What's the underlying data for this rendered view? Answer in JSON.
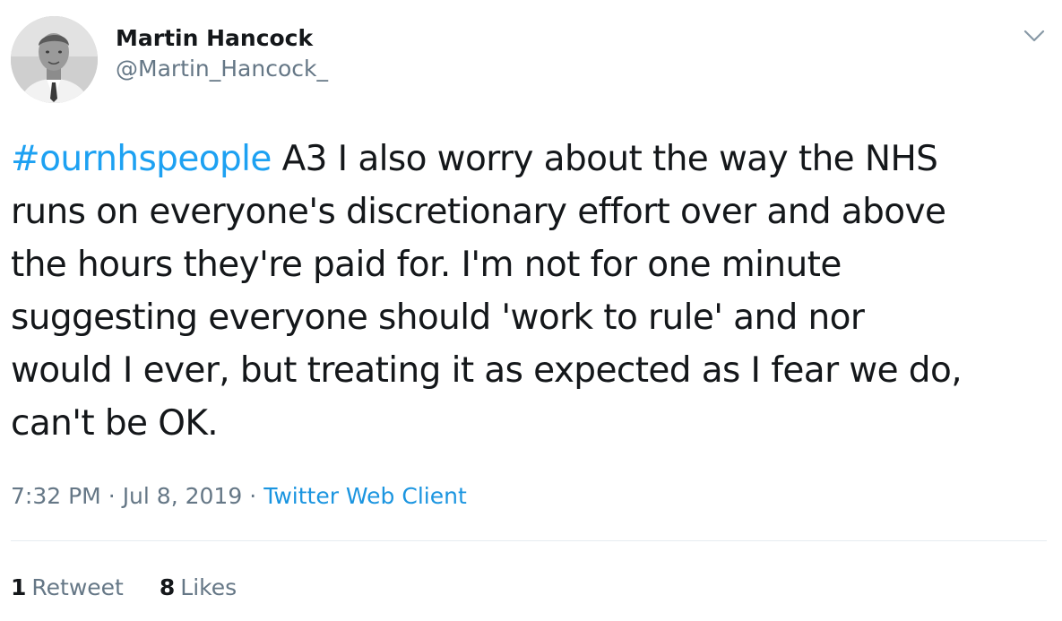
{
  "author": {
    "display_name": "Martin Hancock",
    "handle": "@Martin_Hancock_",
    "avatar_icon": "profile-photo"
  },
  "menu": {
    "icon": "chevron-down-icon"
  },
  "tweet": {
    "hashtag": "#ournhspeople",
    "line1_rest": " A3 I also worry about the way the NHS",
    "line2": "runs on everyone's discretionary effort over and above",
    "line3": "the hours they're paid for. I'm not for one minute",
    "line4": "suggesting everyone should 'work to rule' and nor",
    "line5": "would I ever, but treating it as expected as I fear we do,",
    "line6": "can't be OK."
  },
  "meta": {
    "time": "7:32 PM",
    "separator": "·",
    "date": "Jul 8, 2019",
    "source": "Twitter Web Client"
  },
  "stats": {
    "retweets_count": "1",
    "retweets_label": "Retweet",
    "likes_count": "8",
    "likes_label": "Likes"
  },
  "colors": {
    "text": "#14171a",
    "secondary": "#657786",
    "link": "#1da1f2",
    "divider": "#e6ecf0"
  }
}
